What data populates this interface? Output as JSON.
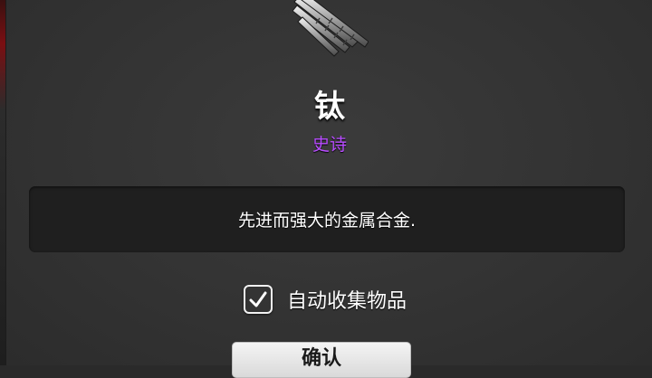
{
  "item": {
    "name": "钛",
    "rarity": "史诗",
    "rarity_color": "#b84dff",
    "description": "先进而强大的金属合金.",
    "icon": "titanium-rebar-icon"
  },
  "auto_collect": {
    "label": "自动收集物品",
    "checked": true
  },
  "confirm_button": {
    "label": "确认"
  }
}
